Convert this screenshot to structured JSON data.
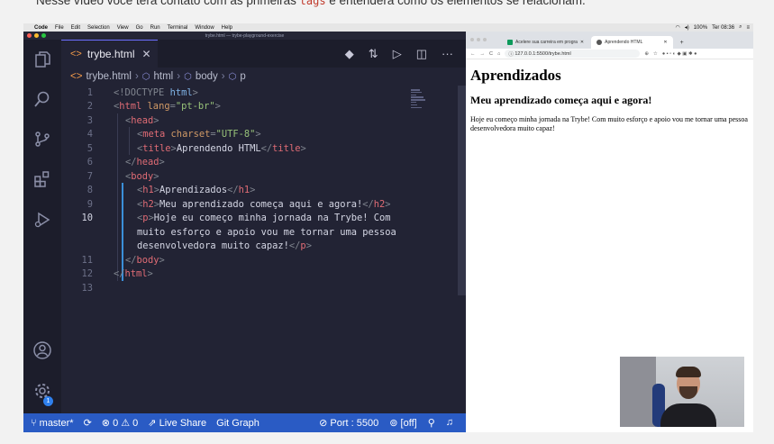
{
  "caption": {
    "before": "Nesse vídeo você terá contato com as primeiras ",
    "tag": "tags",
    "after": " e entenderá como os elementos se relacionam."
  },
  "menubar": {
    "apple": "",
    "app": "Code",
    "items": [
      "File",
      "Edit",
      "Selection",
      "View",
      "Go",
      "Run",
      "Terminal",
      "Window",
      "Help"
    ],
    "battery": "100%",
    "clock": "Ter 08:36"
  },
  "vscode": {
    "window_title": "trybe.html — trybe-playground-exercise",
    "tab": {
      "name": "trybe.html"
    },
    "breadcrumb": [
      "trybe.html",
      "html",
      "body",
      "p"
    ],
    "lines": [
      {
        "n": "1"
      },
      {
        "n": "2"
      },
      {
        "n": "3"
      },
      {
        "n": "4"
      },
      {
        "n": "5"
      },
      {
        "n": "6"
      },
      {
        "n": "7"
      },
      {
        "n": "8"
      },
      {
        "n": "9"
      },
      {
        "n": "10"
      },
      {
        "n": ""
      },
      {
        "n": ""
      },
      {
        "n": "11"
      },
      {
        "n": "12"
      },
      {
        "n": "13"
      }
    ],
    "code": {
      "l1_doctype": "<!DOCTYPE",
      "l1_html": " html",
      "l1_end": ">",
      "l2_open": "<",
      "l2_tag": "html",
      "l2_attr": " lang",
      "l2_eq": "=",
      "l2_val": "\"pt-br\"",
      "l2_close": ">",
      "l3": "head",
      "l4_tag": "meta",
      "l4_attr": " charset",
      "l4_val": "\"UTF-8\"",
      "l5_tag": "title",
      "l5_text": "Aprendendo HTML",
      "l6": "head",
      "l7": "body",
      "l8_tag": "h1",
      "l8_text": "Aprendizados",
      "l9_tag": "h2",
      "l9_text": "Meu aprendizado começa aqui e agora!",
      "l10_tag": "p",
      "l10_text": "Hoje eu começo minha jornada na Trybe! Com",
      "l10b_text": "muito esforço e apoio vou me tornar uma pessoa",
      "l10c_text": "desenvolvedora muito capaz!",
      "l11": "body",
      "l12": "html"
    },
    "status": {
      "branch": "master*",
      "errors": "0",
      "warnings": "0",
      "live_share": "Live Share",
      "git_graph": "Git Graph",
      "port": "Port : 5500",
      "off": "[off]"
    }
  },
  "browser": {
    "tabs": [
      {
        "title": "Acelere sua carreira em progra",
        "favicon_color": "#0d9a5b"
      },
      {
        "title": "Aprendendo HTML",
        "favicon_color": "#555555"
      }
    ],
    "url": "127.0.0.1:5500/trybe.html",
    "content": {
      "h1": "Aprendizados",
      "h2": "Meu aprendizado começa aqui e agora!",
      "p": "Hoje eu começo minha jornada na Trybe! Com muito esforço e apoio vou me tornar uma pessoa desenvolvedora muito capaz!"
    }
  },
  "colors": {
    "status_bar": "#2a5bc4",
    "editor_bg": "#222334",
    "tag_color": "#e06c75",
    "string_color": "#98c379"
  }
}
